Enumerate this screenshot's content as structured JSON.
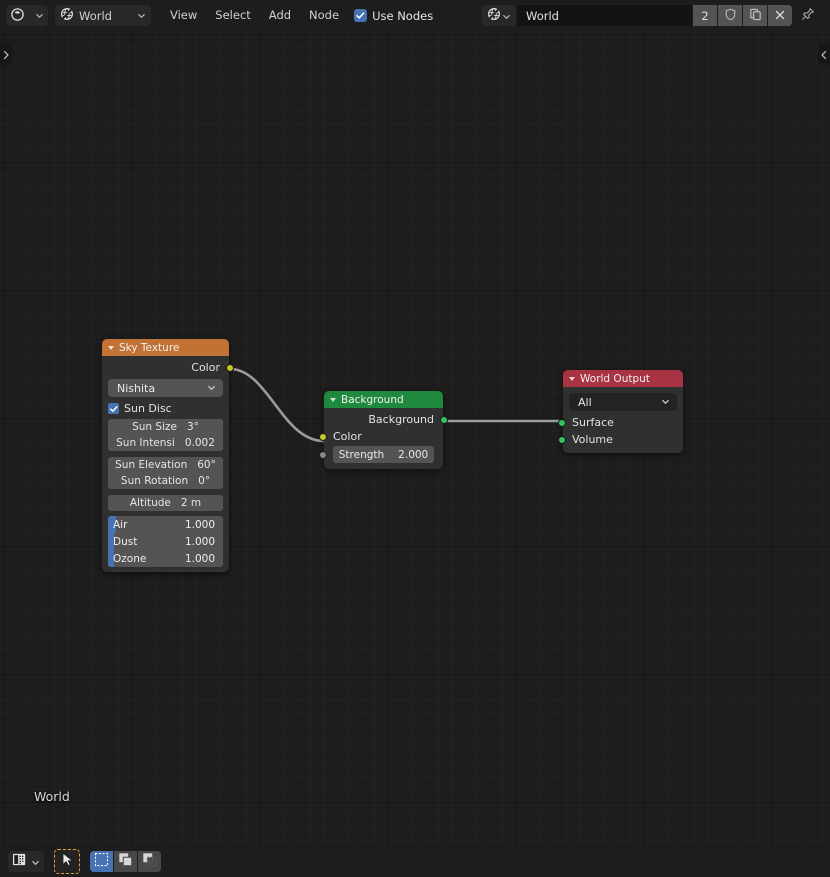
{
  "topbar": {
    "editor_type_icon": "shader-editor-icon",
    "shader_type": {
      "icon": "world-icon",
      "label": "World",
      "chevron": "chevron-down-icon"
    },
    "menus": [
      {
        "name": "view",
        "label": "View"
      },
      {
        "name": "select",
        "label": "Select"
      },
      {
        "name": "add",
        "label": "Add"
      },
      {
        "name": "node",
        "label": "Node"
      }
    ],
    "use_nodes": {
      "label": "Use Nodes",
      "checked": true
    },
    "datablock": {
      "browse_icon": "world-browse-icon",
      "name": "World",
      "users": "2",
      "fake_user_icon": "shield-icon",
      "new_icon": "duplicate-icon",
      "unlink_icon": "close-icon",
      "pin_icon": "pin-icon"
    }
  },
  "canvas": {
    "overlay_label": "World",
    "left_toggle_icon": "chevron-right-icon",
    "right_toggle_icon": "chevron-left-icon",
    "accent_colors": {
      "texture_header": "#c17234",
      "shader_header": "#1f8a3e",
      "output_header": "#a83342",
      "socket_color": "#c7c729",
      "socket_shader": "#30c45d",
      "wire": "#9e9e9e",
      "slider_fill": "#4772b3"
    }
  },
  "nodes": {
    "sky_texture": {
      "title": "Sky Texture",
      "collapse_icon": "triangle-down-icon",
      "outputs": [
        {
          "name": "color-output",
          "label": "Color",
          "socket": "color"
        }
      ],
      "sky_type": {
        "value": "Nishita",
        "chevron": "chevron-down-icon"
      },
      "sun_disc": {
        "label": "Sun Disc",
        "checked": true
      },
      "fields": [
        {
          "name": "sun-size",
          "label": "Sun Size",
          "value": "3°"
        },
        {
          "name": "sun-intensity",
          "label": "Sun Intensi",
          "value": "0.002"
        },
        {
          "name": "sun-elevation",
          "label": "Sun Elevation",
          "value": "60°"
        },
        {
          "name": "sun-rotation",
          "label": "Sun Rotation",
          "value": "0°"
        },
        {
          "name": "altitude",
          "label": "Altitude",
          "value": "2 m"
        }
      ],
      "sliders": [
        {
          "name": "air",
          "label": "Air",
          "value": "1.000",
          "fill_pct": 7
        },
        {
          "name": "dust",
          "label": "Dust",
          "value": "1.000",
          "fill_pct": 5
        },
        {
          "name": "ozone",
          "label": "Ozone",
          "value": "1.000",
          "fill_pct": 5
        }
      ]
    },
    "background": {
      "title": "Background",
      "collapse_icon": "triangle-down-icon",
      "outputs": [
        {
          "name": "background-output",
          "label": "Background",
          "socket": "shader"
        }
      ],
      "inputs": [
        {
          "name": "color-input",
          "label": "Color",
          "socket": "color"
        }
      ],
      "strength": {
        "label": "Strength",
        "value": "2.000",
        "socket": "gray"
      }
    },
    "world_output": {
      "title": "World Output",
      "collapse_icon": "triangle-down-icon",
      "target": {
        "value": "All",
        "chevron": "chevron-down-icon"
      },
      "inputs": [
        {
          "name": "surface-input",
          "label": "Surface",
          "socket": "shader"
        },
        {
          "name": "volume-input",
          "label": "Volume",
          "socket": "shader"
        }
      ]
    }
  },
  "bottombar": {
    "snap_icon": "snap-node-icon",
    "snap_chevron": "chevron-down-icon",
    "tweak_tool_icon": "cursor-arrow-icon",
    "select_modes": [
      {
        "name": "select-box",
        "icon": "select-box-icon",
        "active": true
      },
      {
        "name": "select-extend",
        "icon": "select-extend-icon",
        "active": false
      },
      {
        "name": "select-subtract",
        "icon": "select-subtract-icon",
        "active": false
      }
    ]
  }
}
